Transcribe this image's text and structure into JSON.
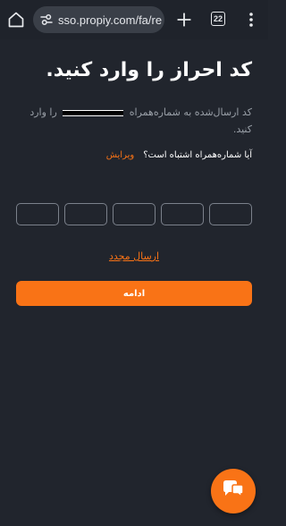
{
  "browser": {
    "url": "sso.propiy.com/fa/re",
    "tab_count": "22"
  },
  "page": {
    "title": "کد احراز را وارد کنید.",
    "subtitle_before": "کد ارسال‌شده به شماره‌همراه",
    "subtitle_after": "را وارد کنید.",
    "wrong_number_question": "آیا شماره‌همراه اشتباه است؟",
    "edit_label": "ویرایش",
    "resend_label": "ارسال مجدد",
    "continue_label": "ادامه"
  },
  "colors": {
    "accent": "#f97316",
    "background": "#21252d"
  },
  "icons": [
    "home-icon",
    "site-settings-icon",
    "plus-icon",
    "tabs-icon",
    "menu-dots-icon",
    "chat-icon"
  ]
}
